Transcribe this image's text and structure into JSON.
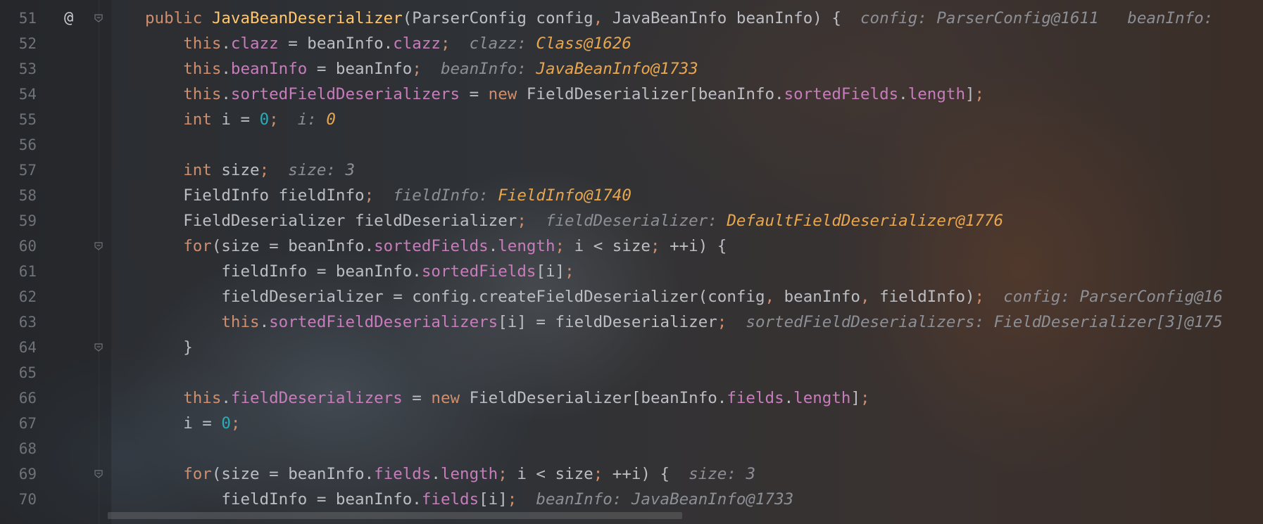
{
  "editor": {
    "gutter_marker": "@",
    "lines": [
      {
        "n": "51",
        "indent": "",
        "tokens": [
          [
            "kw",
            "public "
          ],
          [
            "fnd",
            "JavaBeanDeserializer"
          ],
          [
            "pl",
            "(ParserConfig config"
          ],
          [
            "kw",
            ","
          ],
          [
            "pl",
            " JavaBeanInfo beanInfo) {"
          ],
          [
            "pl",
            "  "
          ],
          [
            "hint",
            "config: ParserConfig@1611"
          ],
          [
            "pl",
            "   "
          ],
          [
            "hint",
            "beanInfo: "
          ]
        ],
        "fold": true,
        "marker": true
      },
      {
        "n": "52",
        "indent": "    ",
        "tokens": [
          [
            "kw",
            "this"
          ],
          [
            "pl",
            "."
          ],
          [
            "fld",
            "clazz"
          ],
          [
            "pl",
            " = beanInfo."
          ],
          [
            "fld",
            "clazz"
          ],
          [
            "kw",
            ";"
          ],
          [
            "pl",
            "  "
          ],
          [
            "hint",
            "clazz: "
          ],
          [
            "hv",
            "Class@1626"
          ]
        ]
      },
      {
        "n": "53",
        "indent": "    ",
        "tokens": [
          [
            "kw",
            "this"
          ],
          [
            "pl",
            "."
          ],
          [
            "fld",
            "beanInfo"
          ],
          [
            "pl",
            " = beanInfo"
          ],
          [
            "kw",
            ";"
          ],
          [
            "pl",
            "  "
          ],
          [
            "hint",
            "beanInfo: "
          ],
          [
            "hv",
            "JavaBeanInfo@1733"
          ]
        ]
      },
      {
        "n": "54",
        "indent": "    ",
        "tokens": [
          [
            "kw",
            "this"
          ],
          [
            "pl",
            "."
          ],
          [
            "fld",
            "sortedFieldDeserializers"
          ],
          [
            "pl",
            " = "
          ],
          [
            "kw",
            "new "
          ],
          [
            "pl",
            "FieldDeserializer[beanInfo."
          ],
          [
            "fld",
            "sortedFields"
          ],
          [
            "pl",
            "."
          ],
          [
            "fld",
            "length"
          ],
          [
            "pl",
            "]"
          ],
          [
            "kw",
            ";"
          ]
        ]
      },
      {
        "n": "55",
        "indent": "    ",
        "tokens": [
          [
            "kw",
            "int "
          ],
          [
            "pl",
            "i = "
          ],
          [
            "num",
            "0"
          ],
          [
            "kw",
            ";"
          ],
          [
            "pl",
            "  "
          ],
          [
            "hint",
            "i: "
          ],
          [
            "hv",
            "0"
          ]
        ]
      },
      {
        "n": "56",
        "indent": "",
        "tokens": []
      },
      {
        "n": "57",
        "indent": "    ",
        "tokens": [
          [
            "kw",
            "int "
          ],
          [
            "pl",
            "size"
          ],
          [
            "kw",
            ";"
          ],
          [
            "pl",
            "  "
          ],
          [
            "hint",
            "size: 3"
          ]
        ]
      },
      {
        "n": "58",
        "indent": "    ",
        "tokens": [
          [
            "pl",
            "FieldInfo fieldInfo"
          ],
          [
            "kw",
            ";"
          ],
          [
            "pl",
            "  "
          ],
          [
            "hint",
            "fieldInfo: "
          ],
          [
            "hv",
            "FieldInfo@1740"
          ]
        ]
      },
      {
        "n": "59",
        "indent": "    ",
        "tokens": [
          [
            "pl",
            "FieldDeserializer fieldDeserializer"
          ],
          [
            "kw",
            ";"
          ],
          [
            "pl",
            "  "
          ],
          [
            "hint",
            "fieldDeserializer: "
          ],
          [
            "hv",
            "DefaultFieldDeserializer@1776"
          ]
        ]
      },
      {
        "n": "60",
        "indent": "    ",
        "tokens": [
          [
            "kw",
            "for"
          ],
          [
            "pl",
            "(size = beanInfo."
          ],
          [
            "fld",
            "sortedFields"
          ],
          [
            "pl",
            "."
          ],
          [
            "fld",
            "length"
          ],
          [
            "kw",
            ";"
          ],
          [
            "pl",
            " i < size"
          ],
          [
            "kw",
            ";"
          ],
          [
            "pl",
            " ++i) {"
          ]
        ],
        "fold": true
      },
      {
        "n": "61",
        "indent": "        ",
        "tokens": [
          [
            "pl",
            "fieldInfo = beanInfo."
          ],
          [
            "fld",
            "sortedFields"
          ],
          [
            "pl",
            "[i]"
          ],
          [
            "kw",
            ";"
          ]
        ]
      },
      {
        "n": "62",
        "indent": "        ",
        "tokens": [
          [
            "pl",
            "fieldDeserializer = config.createFieldDeserializer(config"
          ],
          [
            "kw",
            ","
          ],
          [
            "pl",
            " beanInfo"
          ],
          [
            "kw",
            ","
          ],
          [
            "pl",
            " fieldInfo)"
          ],
          [
            "kw",
            ";"
          ],
          [
            "pl",
            "  "
          ],
          [
            "hint",
            "config: ParserConfig@16"
          ]
        ]
      },
      {
        "n": "63",
        "indent": "        ",
        "tokens": [
          [
            "kw",
            "this"
          ],
          [
            "pl",
            "."
          ],
          [
            "fld",
            "sortedFieldDeserializers"
          ],
          [
            "pl",
            "[i] = fieldDeserializer"
          ],
          [
            "kw",
            ";"
          ],
          [
            "pl",
            "  "
          ],
          [
            "hint",
            "sortedFieldDeserializers: FieldDeserializer[3]@175"
          ]
        ]
      },
      {
        "n": "64",
        "indent": "    ",
        "tokens": [
          [
            "pl",
            "}"
          ]
        ],
        "fold": true
      },
      {
        "n": "65",
        "indent": "",
        "tokens": []
      },
      {
        "n": "66",
        "indent": "    ",
        "tokens": [
          [
            "kw",
            "this"
          ],
          [
            "pl",
            "."
          ],
          [
            "fld",
            "fieldDeserializers"
          ],
          [
            "pl",
            " = "
          ],
          [
            "kw",
            "new "
          ],
          [
            "pl",
            "FieldDeserializer[beanInfo."
          ],
          [
            "fld",
            "fields"
          ],
          [
            "pl",
            "."
          ],
          [
            "fld",
            "length"
          ],
          [
            "pl",
            "]"
          ],
          [
            "kw",
            ";"
          ]
        ]
      },
      {
        "n": "67",
        "indent": "    ",
        "tokens": [
          [
            "pl",
            "i = "
          ],
          [
            "num",
            "0"
          ],
          [
            "kw",
            ";"
          ]
        ]
      },
      {
        "n": "68",
        "indent": "",
        "tokens": []
      },
      {
        "n": "69",
        "indent": "    ",
        "tokens": [
          [
            "kw",
            "for"
          ],
          [
            "pl",
            "(size = beanInfo."
          ],
          [
            "fld",
            "fields"
          ],
          [
            "pl",
            "."
          ],
          [
            "fld",
            "length"
          ],
          [
            "kw",
            ";"
          ],
          [
            "pl",
            " i < size"
          ],
          [
            "kw",
            ";"
          ],
          [
            "pl",
            " ++i) {"
          ],
          [
            "pl",
            "  "
          ],
          [
            "hint",
            "size: 3"
          ]
        ],
        "fold": true
      },
      {
        "n": "70",
        "indent": "        ",
        "tokens": [
          [
            "pl",
            "fieldInfo = beanInfo."
          ],
          [
            "fld",
            "fields"
          ],
          [
            "pl",
            "[i]"
          ],
          [
            "kw",
            ";"
          ],
          [
            "pl",
            "  "
          ],
          [
            "hint",
            "beanInfo: JavaBeanInfo@1733"
          ]
        ]
      }
    ]
  }
}
